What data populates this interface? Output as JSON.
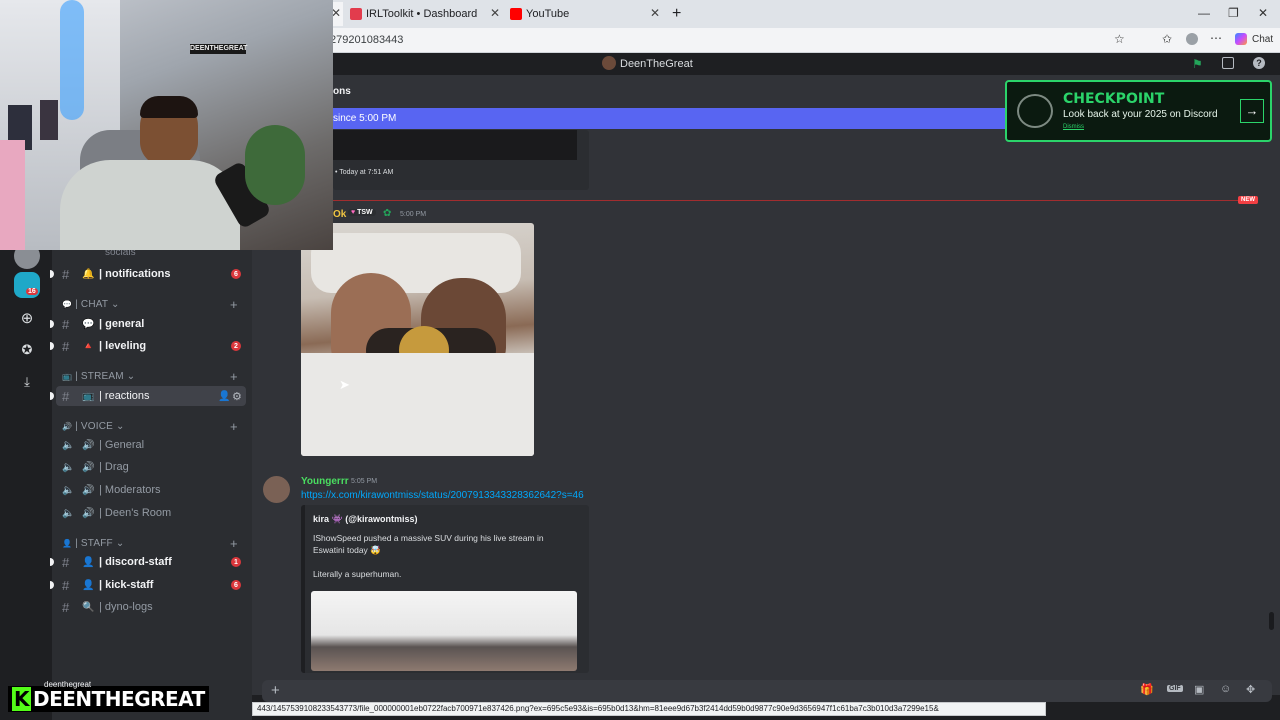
{
  "browser": {
    "tabs": [
      {
        "title": "IRLToolkit • Dashboard",
        "fav_color": "#e23c4d"
      },
      {
        "title": "YouTube",
        "fav_color": "#ff0000"
      }
    ],
    "new_tab": "+",
    "url": "279201083443",
    "chat_label": "Chat",
    "status_url": "443/1457539108233543773/file_000000001eb0722facb700971e837426.png?ex=695c5e93&is=695b0d13&hm=81eee9d67b3f2414dd59b0d9877c90e9d3656947f1c61ba7c3b010d3a7299e15&"
  },
  "discord": {
    "window_title": "DeenTheGreat",
    "banner_text": "since 5:00 PM",
    "header_partial": "ons",
    "prev_embed_meta": "• Today at 7:51 AM",
    "new_label": "NEW",
    "checkpoint": {
      "title": "CHECKPOINT",
      "subtitle": "Look back at your 2025 on Discord",
      "dismiss": "Dismiss"
    },
    "messages": [
      {
        "author": "Ok",
        "author_color": "#f0c542",
        "tag": "TSW",
        "time": "5:00 PM"
      },
      {
        "author": "Youngerrr",
        "author_color": "#4ade60",
        "time": "5:05 PM",
        "link": "https://x.com/kirawontmiss/status/2007913343328362642?s=46",
        "embed": {
          "author": "kira 👾 (@kirawontmiss)",
          "line1": "IShowSpeed pushed a massive SUV during his live stream in",
          "line2": "Eswatini today 🤯",
          "line3": "Literally a superhuman."
        }
      }
    ]
  },
  "sidebar": {
    "partial_top": "socials",
    "categories": [
      {
        "label": "| CHAT ⌄",
        "icon": "💬"
      },
      {
        "label": "| STREAM ⌄",
        "icon": "📺"
      },
      {
        "label": "| VOICE ⌄",
        "icon": "🔊"
      },
      {
        "label": "| STAFF ⌄",
        "icon": "👤"
      }
    ],
    "channels": [
      {
        "name": "| notifications",
        "emoji": "🔔",
        "badge": "6"
      },
      {
        "name": "| general",
        "emoji": "💬"
      },
      {
        "name": "| leveling",
        "emoji": "🔺",
        "badge": "2"
      },
      {
        "name": "| reactions",
        "emoji": "📺"
      },
      {
        "name": "| General",
        "emoji": "🔊"
      },
      {
        "name": "| Drag",
        "emoji": "🔊"
      },
      {
        "name": "| Moderators",
        "emoji": "🔊"
      },
      {
        "name": "| Deen's Room",
        "emoji": "🔊"
      },
      {
        "name": "| discord-staff",
        "emoji": "👤",
        "badge": "1"
      },
      {
        "name": "| kick-staff",
        "emoji": "👤",
        "badge": "6"
      },
      {
        "name": "| dyno-logs",
        "emoji": "🔍"
      }
    ],
    "server_badge": "16",
    "user_partial": "deenthegreat"
  },
  "overlay": {
    "logo_k": "K",
    "logo_text": "DEENTHEGREAT",
    "cam_sign": "DEENTHEGREAT"
  }
}
